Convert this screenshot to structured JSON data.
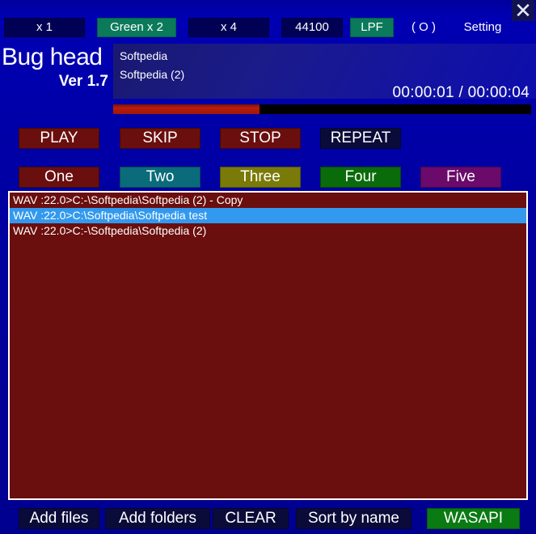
{
  "window": {
    "title": "Bug head",
    "close_label": "✕"
  },
  "logo": {
    "name": "Bug head",
    "version": "Ver 1.7"
  },
  "toolbar": {
    "items": [
      {
        "label": "x 1",
        "style": "normal"
      },
      {
        "label": "Green x 2",
        "style": "green"
      },
      {
        "label": "x 4",
        "style": "normal"
      },
      {
        "label": "44100",
        "style": "normal"
      },
      {
        "label": "LPF",
        "style": "green"
      },
      {
        "label": "( O )",
        "style": "plain"
      },
      {
        "label": "Setting",
        "style": "plain"
      }
    ]
  },
  "info": {
    "line1": "Softpedia",
    "line2": "Softpedia (2)",
    "time_current": "00:00:01",
    "time_total": "00:00:04",
    "time_display": "00:00:01 / 00:00:04"
  },
  "progress": {
    "percent": 35
  },
  "transport": [
    {
      "label": "PLAY",
      "style": "red"
    },
    {
      "label": "SKIP",
      "style": "red"
    },
    {
      "label": "STOP",
      "style": "red"
    },
    {
      "label": "REPEAT",
      "style": "dark"
    }
  ],
  "presets": [
    {
      "label": "One",
      "color": "#6b0e0e"
    },
    {
      "label": "Two",
      "color": "#0a6b7a"
    },
    {
      "label": "Three",
      "color": "#7a7a08"
    },
    {
      "label": "Four",
      "color": "#0a6b0a"
    },
    {
      "label": "Five",
      "color": "#6b0a6b"
    }
  ],
  "playlist": {
    "rows": [
      {
        "text": "WAV :22.0>C:-\\Softpedia\\Softpedia (2) - Copy",
        "selected": false
      },
      {
        "text": "WAV :22.0>C:\\Softpedia\\Softpedia test",
        "selected": true
      },
      {
        "text": "WAV :22.0>C:-\\Softpedia\\Softpedia (2)",
        "selected": false
      }
    ]
  },
  "bottom": [
    {
      "label": "Add files",
      "style": "dark"
    },
    {
      "label": "Add folders",
      "style": "dark"
    },
    {
      "label": "CLEAR",
      "style": "dark"
    },
    {
      "label": "Sort by name",
      "style": "dark"
    },
    {
      "label": "WASAPI",
      "style": "green"
    }
  ],
  "colors": {
    "background": "#0000a8",
    "accent_green": "#0a7a5a",
    "accent_red": "#6b0e0e",
    "selection": "#3399ee",
    "wasapi_green": "#0a7a12"
  }
}
